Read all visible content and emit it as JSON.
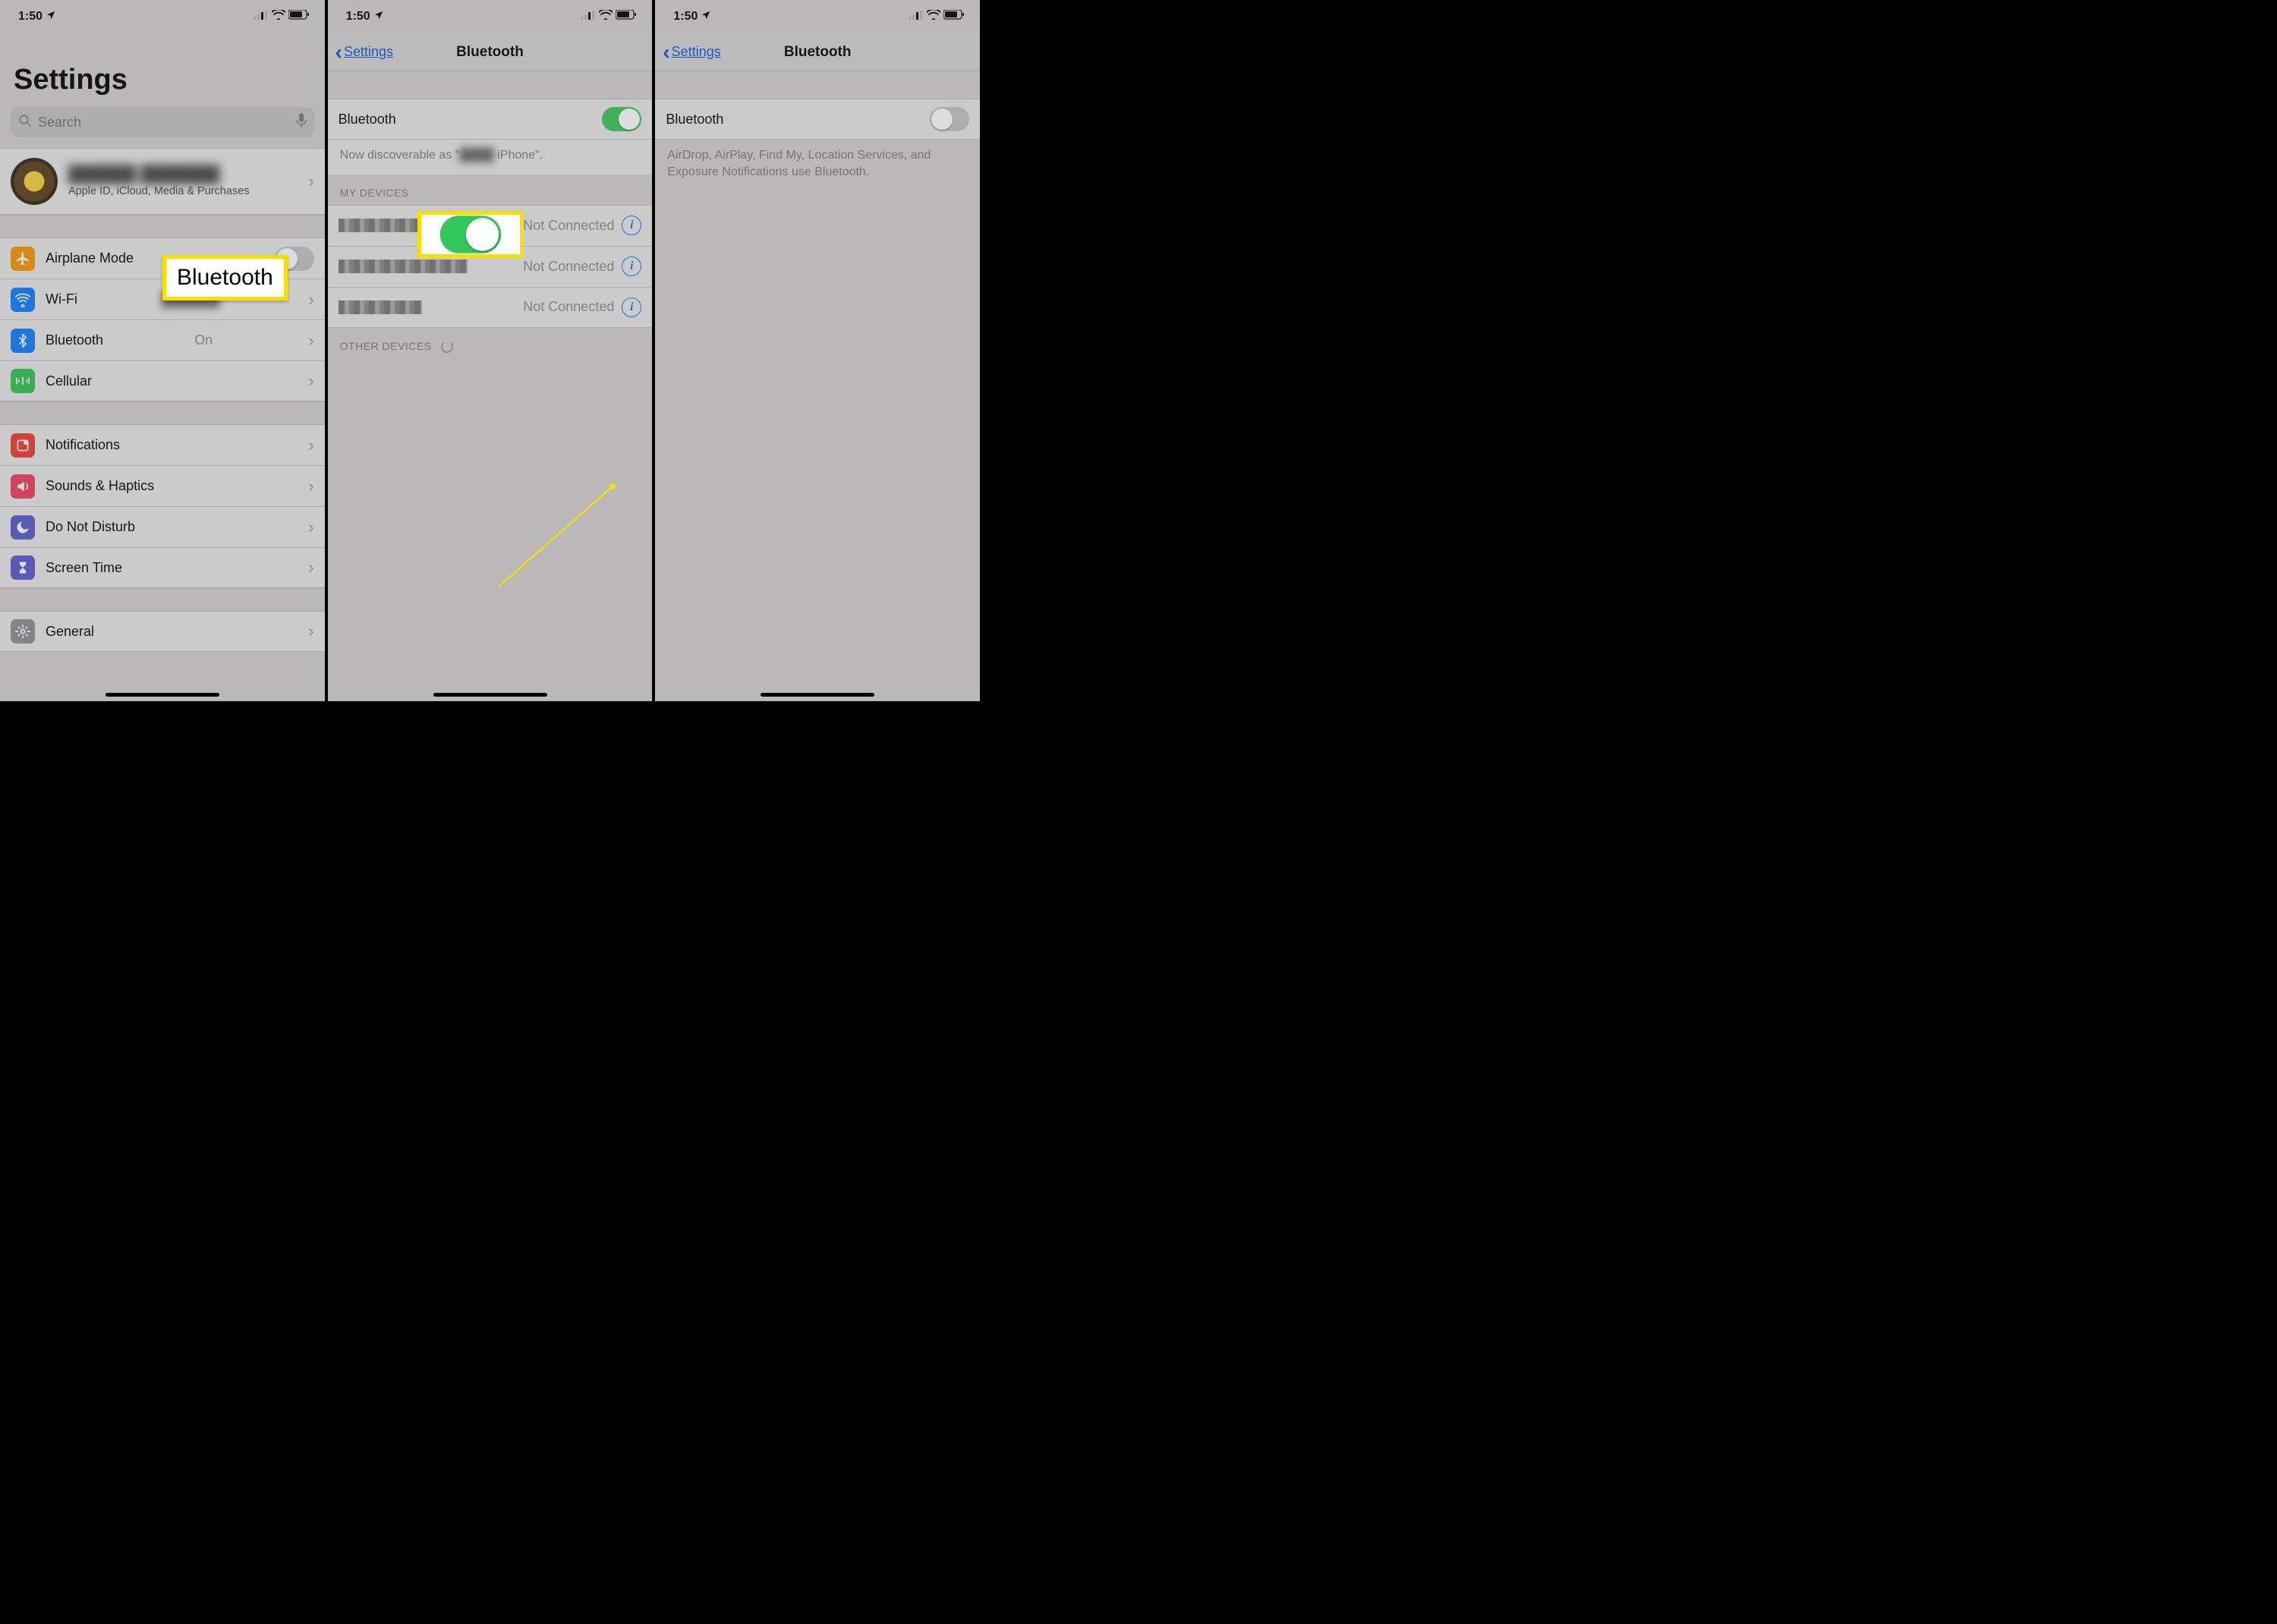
{
  "status": {
    "time": "1:50",
    "loc_icon": "location-arrow"
  },
  "screen1": {
    "title": "Settings",
    "search_placeholder": "Search",
    "profile_sub": "Apple ID, iCloud, Media & Purchases",
    "rows": {
      "airplane": "Airplane Mode",
      "wifi": "Wi-Fi",
      "bluetooth": "Bluetooth",
      "bluetooth_value": "On",
      "cellular": "Cellular",
      "notifications": "Notifications",
      "sounds": "Sounds & Haptics",
      "dnd": "Do Not Disturb",
      "screentime": "Screen Time",
      "general": "General"
    },
    "callout": "Bluetooth",
    "icon_colors": {
      "airplane": "#f89500",
      "wifi": "#0a7aff",
      "bluetooth": "#0a7aff",
      "cellular": "#30c251",
      "notifications": "#eb3b30",
      "sounds": "#eb3b5a",
      "dnd": "#5756ce",
      "screentime": "#5756ce",
      "general": "#8e8e93"
    }
  },
  "screen2": {
    "back": "Settings",
    "title": "Bluetooth",
    "toggle_row_label": "Bluetooth",
    "toggle_on": true,
    "discoverable_prefix": "Now discoverable as \"",
    "discoverable_suffix": " iPhone\".",
    "my_devices_header": "MY DEVICES",
    "devices": [
      {
        "status": "Not Connected"
      },
      {
        "status": "Not Connected"
      },
      {
        "status": "Not Connected"
      }
    ],
    "other_devices_header": "OTHER DEVICES"
  },
  "screen3": {
    "back": "Settings",
    "title": "Bluetooth",
    "toggle_row_label": "Bluetooth",
    "toggle_on": false,
    "note": "AirDrop, AirPlay, Find My, Location Services, and Exposure Notifications use Bluetooth."
  }
}
